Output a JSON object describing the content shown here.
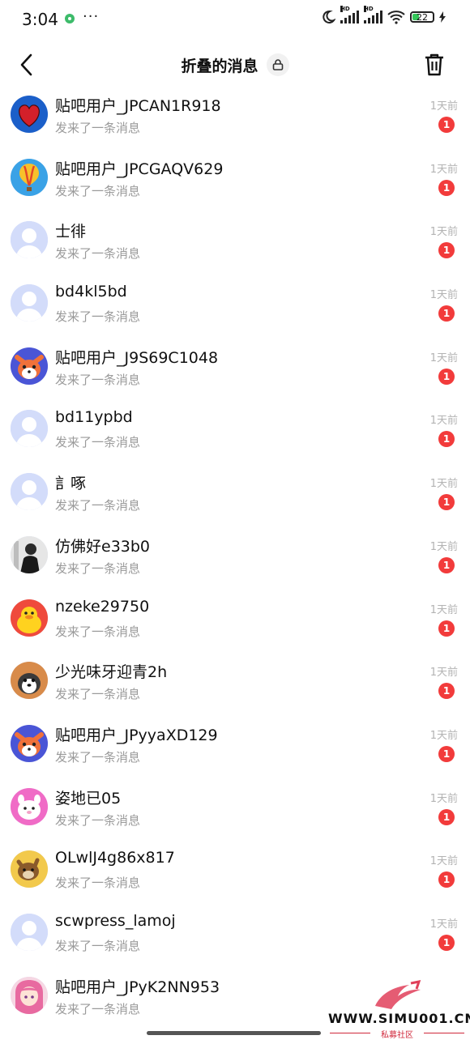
{
  "status_bar": {
    "time": "3:04",
    "more": "···",
    "battery": "22",
    "hd": "HD"
  },
  "header": {
    "title": "折叠的消息"
  },
  "messages": [
    {
      "name": "贴吧用户_JPCAN1R918",
      "preview": "发来了一条消息",
      "time": "1天前",
      "badge": "1",
      "avatar": "heart-avatar"
    },
    {
      "name": "贴吧用户_JPCGAQV629",
      "preview": "发来了一条消息",
      "time": "1天前",
      "badge": "1",
      "avatar": "balloon-avatar"
    },
    {
      "name": "士徘",
      "preview": "发来了一条消息",
      "time": "1天前",
      "badge": "1",
      "avatar": "default-avatar"
    },
    {
      "name": "bd4kl5bd",
      "preview": "发来了一条消息",
      "time": "1天前",
      "badge": "1",
      "avatar": "default-avatar"
    },
    {
      "name": "贴吧用户_J9S69C1048",
      "preview": "发来了一条消息",
      "time": "1天前",
      "badge": "1",
      "avatar": "fox-avatar"
    },
    {
      "name": "bd11ypbd",
      "preview": "发来了一条消息",
      "time": "1天前",
      "badge": "1",
      "avatar": "default-avatar"
    },
    {
      "name": "訁啄",
      "preview": "发来了一条消息",
      "time": "1天前",
      "badge": "1",
      "avatar": "default-avatar"
    },
    {
      "name": "仿佛好e33b0",
      "preview": "发来了一条消息",
      "time": "1天前",
      "badge": "1",
      "avatar": "photo-avatar"
    },
    {
      "name": "nzeke29750",
      "preview": "发来了一条消息",
      "time": "1天前",
      "badge": "1",
      "avatar": "duck-avatar"
    },
    {
      "name": "少光味牙迎青2h",
      "preview": "发来了一条消息",
      "time": "1天前",
      "badge": "1",
      "avatar": "dog-avatar"
    },
    {
      "name": "贴吧用户_JPyyaXD129",
      "preview": "发来了一条消息",
      "time": "1天前",
      "badge": "1",
      "avatar": "fox-avatar"
    },
    {
      "name": "姿地已05",
      "preview": "发来了一条消息",
      "time": "1天前",
      "badge": "1",
      "avatar": "pink-avatar"
    },
    {
      "name": "OLwlJ4g86x817",
      "preview": "发来了一条消息",
      "time": "1天前",
      "badge": "1",
      "avatar": "shiba-avatar"
    },
    {
      "name": "scwpress_lamoj",
      "preview": "发来了一条消息",
      "time": "1天前",
      "badge": "1",
      "avatar": "default-avatar"
    },
    {
      "name": "贴吧用户_JPyK2NN953",
      "preview": "发来了一条消息",
      "time": "",
      "badge": "",
      "avatar": "anime-avatar"
    }
  ],
  "watermark": {
    "site": "WWW.SIMU001.CN",
    "label": "私募社区"
  },
  "colors": {
    "badge": "#f23b3b",
    "muted_text": "#9a9a9a",
    "default_avatar": "#d3dcfa"
  }
}
